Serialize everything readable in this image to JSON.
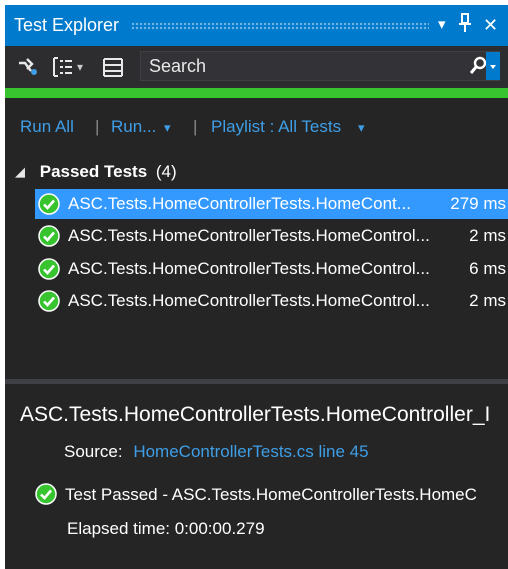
{
  "window": {
    "title": "Test Explorer",
    "dropdown_glyph": "▾",
    "pin_glyph": "⊥",
    "close_glyph": "✕"
  },
  "toolbar": {
    "search_placeholder": "Search",
    "icons": [
      "run-details-icon",
      "group-by-icon",
      "playlist-icon"
    ]
  },
  "progress": {
    "value": 1.0,
    "color": "#37c42f"
  },
  "commands": {
    "run_all": "Run All",
    "separator": "|",
    "run": "Run...",
    "playlist": "Playlist : All Tests",
    "dropdown_glyph": "▾"
  },
  "group": {
    "label": "Passed Tests",
    "count": "(4)",
    "expander_glyph": "◢"
  },
  "tests": [
    {
      "name": "ASC.Tests.HomeControllerTests.HomeCont...",
      "duration": "279 ms",
      "status": "passed",
      "selected": true
    },
    {
      "name": "ASC.Tests.HomeControllerTests.HomeControl...",
      "duration": "2 ms",
      "status": "passed",
      "selected": false
    },
    {
      "name": "ASC.Tests.HomeControllerTests.HomeControl...",
      "duration": "6 ms",
      "status": "passed",
      "selected": false
    },
    {
      "name": "ASC.Tests.HomeControllerTests.HomeControl...",
      "duration": "2 ms",
      "status": "passed",
      "selected": false
    }
  ],
  "detail": {
    "title": "ASC.Tests.HomeControllerTests.HomeController_I",
    "source_label": "Source:",
    "source_link": "HomeControllerTests.cs line 45",
    "result": "Test Passed - ASC.Tests.HomeControllerTests.HomeC",
    "elapsed": "Elapsed time: 0:00:00.279"
  },
  "colors": {
    "accent": "#007acc",
    "selection": "#3399ff",
    "link": "#3e9ee6",
    "passed": "#37c42f",
    "background": "#252526"
  }
}
